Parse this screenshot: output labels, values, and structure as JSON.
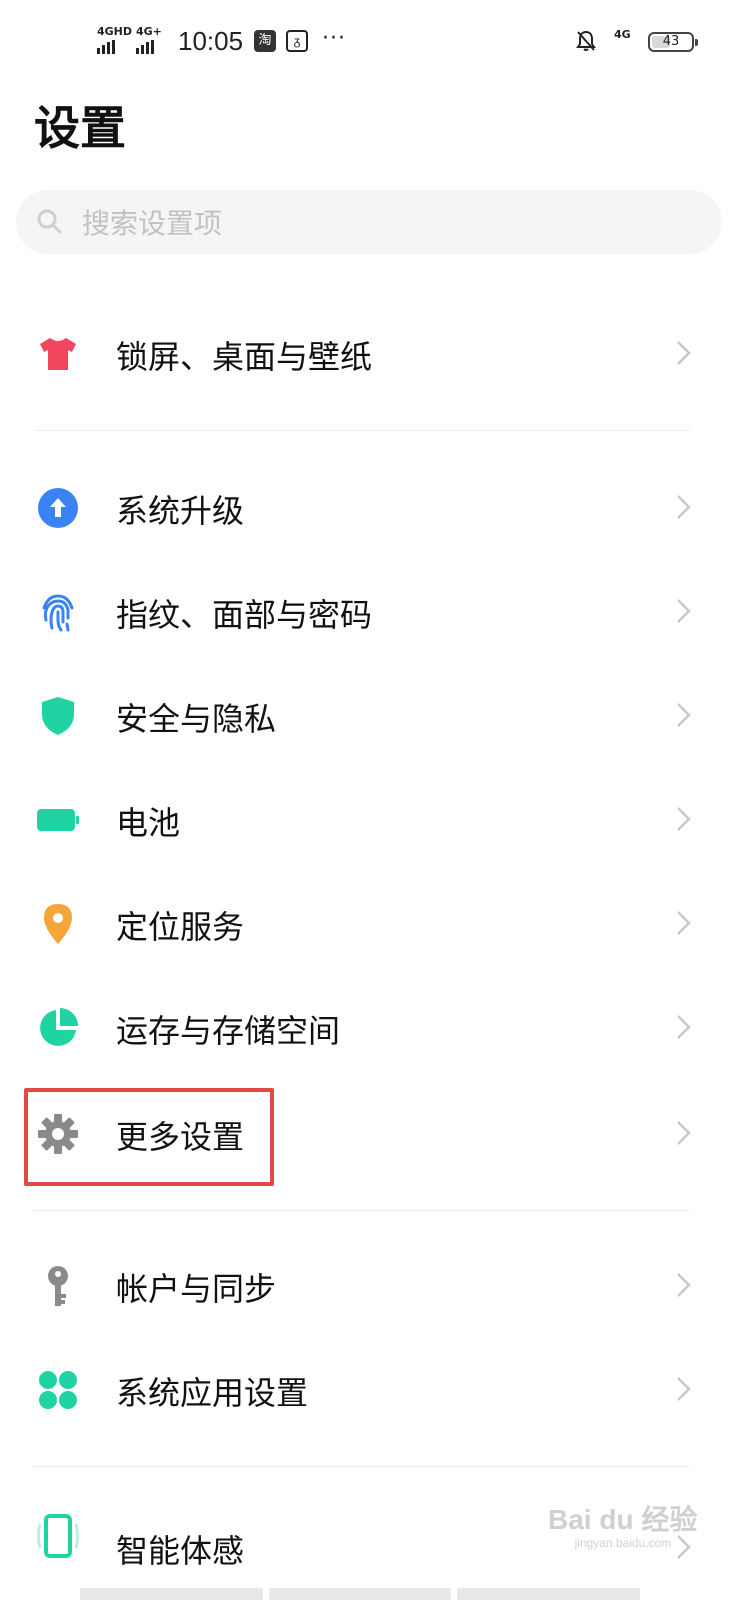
{
  "status_bar": {
    "sim1_network": "4GHD",
    "sim2_network": "4G+",
    "time": "10:05",
    "app_icon_1": "淘",
    "app_icon_2": "ᵹ",
    "more": "···",
    "right_network": "4G",
    "battery_level": "43",
    "battery_fraction": 0.43,
    "icons": [
      "signal-icon",
      "taobao-icon",
      "notification-icon",
      "bell-muted-icon",
      "battery-icon"
    ]
  },
  "header": {
    "title": "设置"
  },
  "search": {
    "placeholder": "搜索设置项",
    "icon": "search-icon"
  },
  "menu": {
    "groups": [
      [
        {
          "label": "锁屏、桌面与壁纸",
          "icon": "tshirt-icon",
          "color": "#f2465e"
        }
      ],
      [
        {
          "label": "系统升级",
          "icon": "upgrade-arrow-icon",
          "color": "#3b82f6"
        },
        {
          "label": "指纹、面部与密码",
          "icon": "fingerprint-icon",
          "color": "#3b82f6"
        },
        {
          "label": "安全与隐私",
          "icon": "shield-icon",
          "color": "#1fd3a2"
        },
        {
          "label": "电池",
          "icon": "battery-icon",
          "color": "#1fd3a2"
        },
        {
          "label": "定位服务",
          "icon": "location-pin-icon",
          "color": "#f5a53a"
        },
        {
          "label": "运存与存储空间",
          "icon": "pie-chart-icon",
          "color": "#1fd3a2"
        },
        {
          "label": "更多设置",
          "icon": "gear-icon",
          "color": "#8a8a8a"
        }
      ],
      [
        {
          "label": "帐户与同步",
          "icon": "key-icon",
          "color": "#8a8a8a"
        },
        {
          "label": "系统应用设置",
          "icon": "apps-grid-icon",
          "color": "#1fd3a2"
        }
      ],
      [
        {
          "label": "智能体感",
          "icon": "phone-motion-icon",
          "color": "#1fd3a2"
        }
      ]
    ],
    "highlighted": "更多设置"
  },
  "watermark": {
    "text": "Bai du 经验",
    "subtext": "jingyan.baidu.com"
  }
}
